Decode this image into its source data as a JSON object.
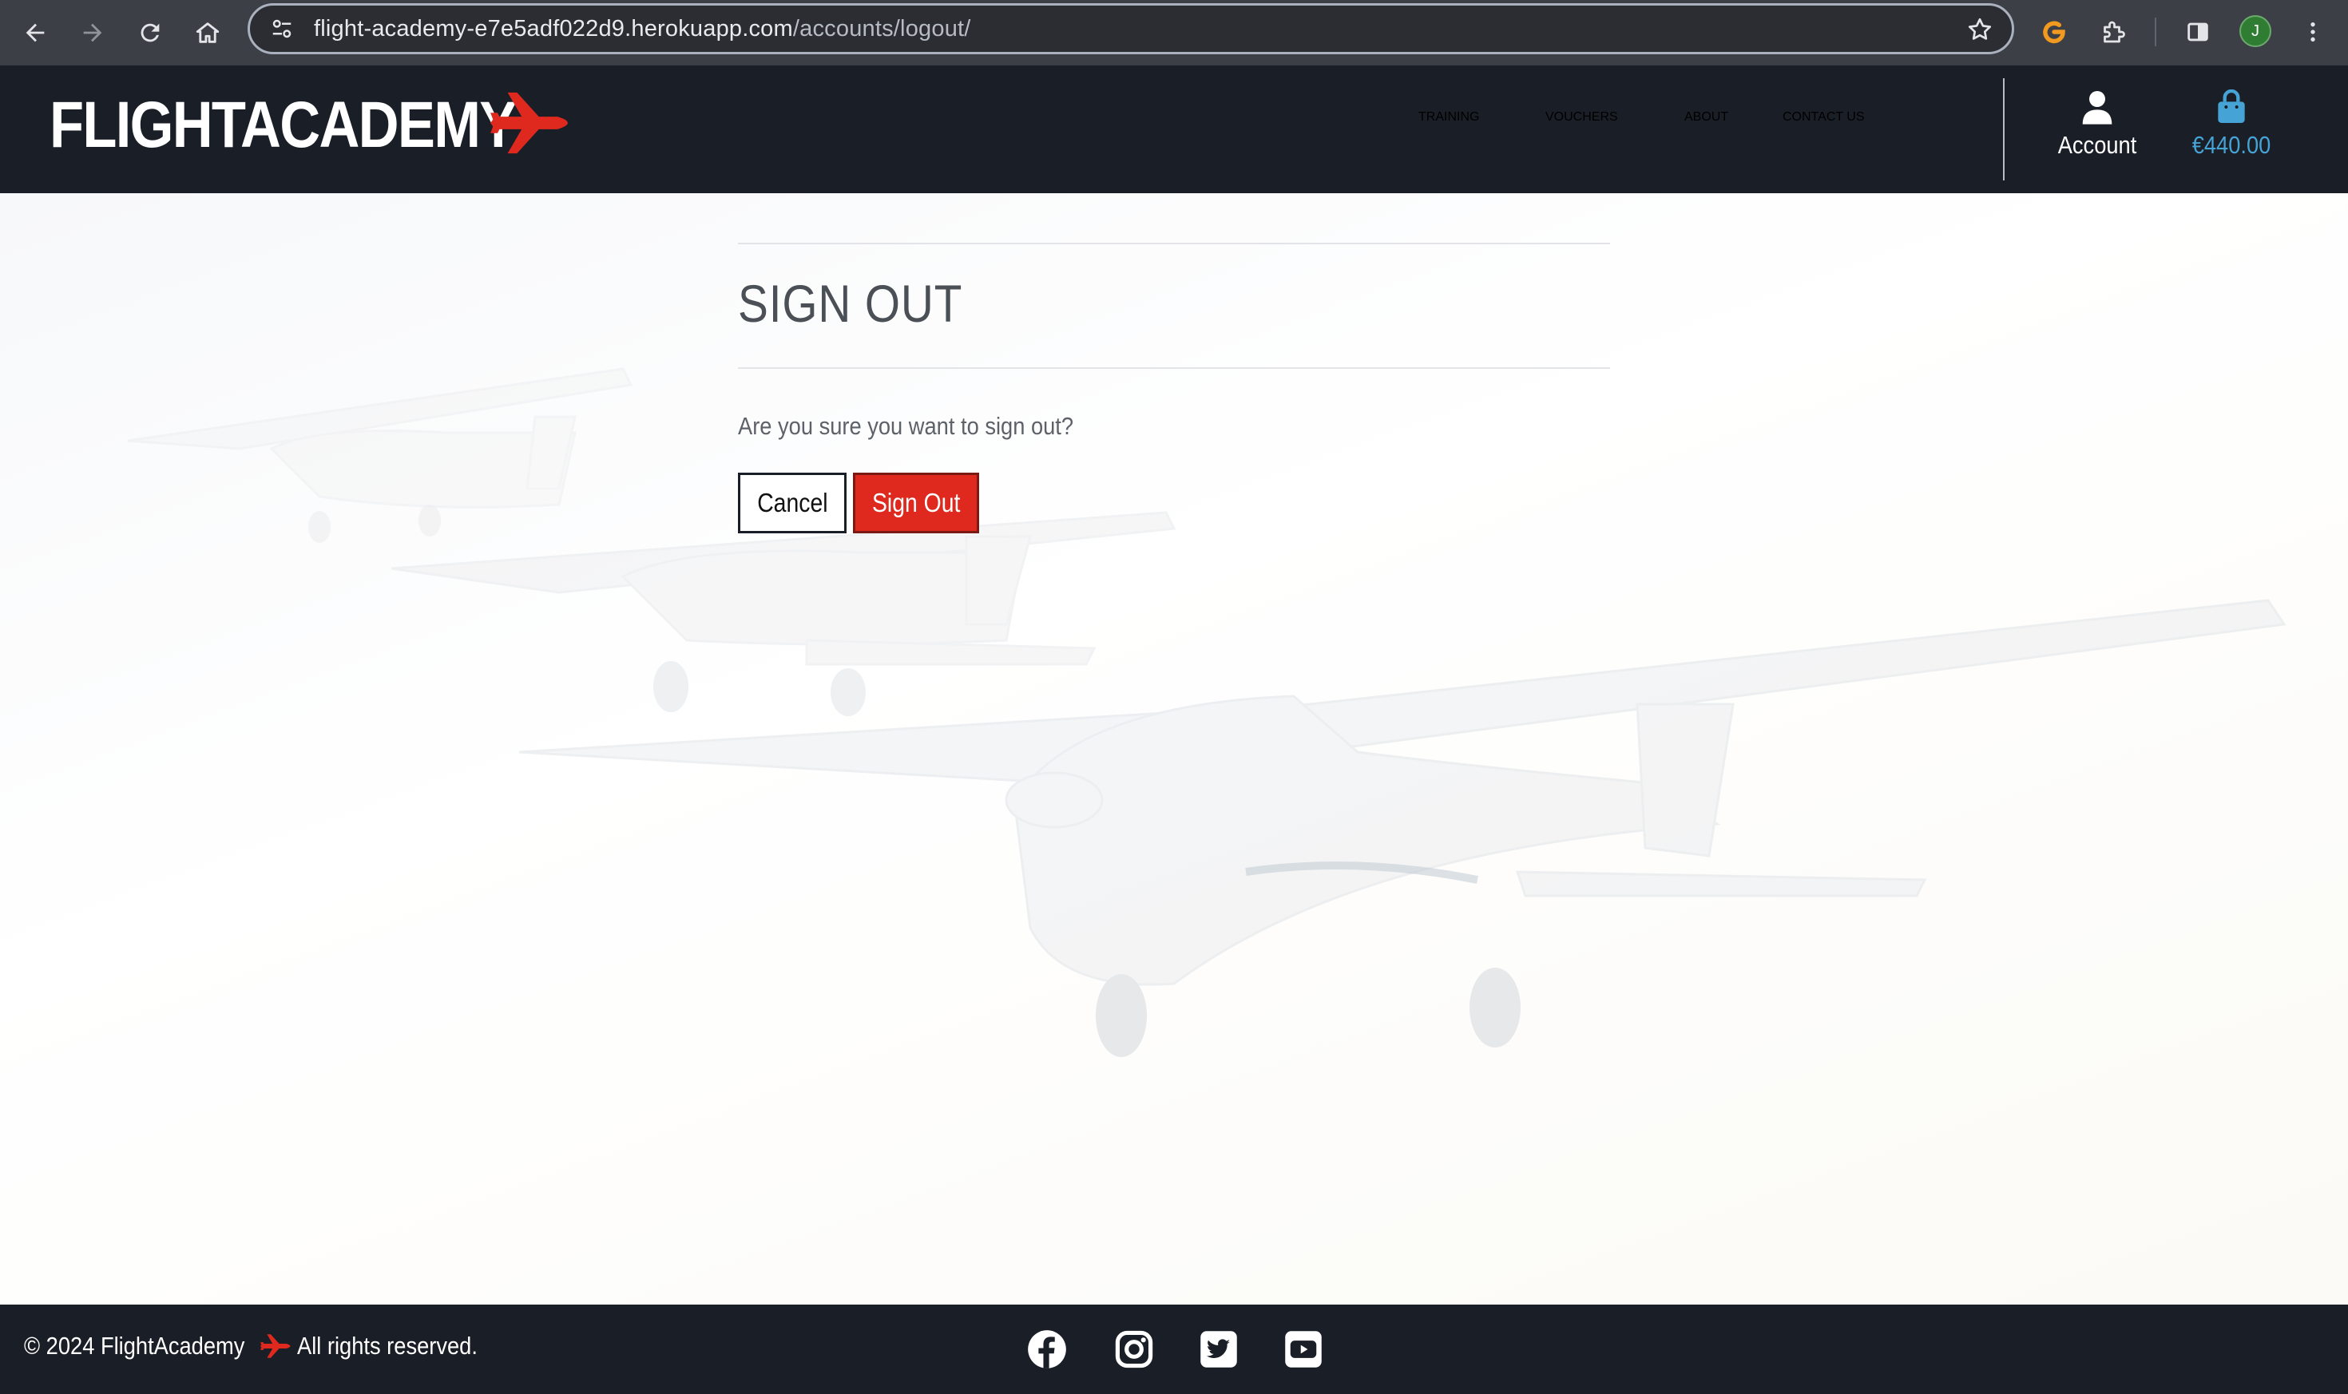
{
  "browser": {
    "url_host": "flight-academy-e7e5adf022d9.herokuapp.com",
    "url_path": "/accounts/logout/",
    "profile_initial": "J",
    "icons": [
      "back-arrow-icon",
      "forward-arrow-icon",
      "reload-icon",
      "home-icon",
      "site-info-icon",
      "star-icon",
      "extension-g-icon",
      "puzzle-icon",
      "sidebar-icon",
      "kebab-menu-icon"
    ]
  },
  "header": {
    "logo_text": "FLIGHTACADEMY",
    "nav": [
      "TRAINING",
      "VOUCHERS",
      "ABOUT",
      "CONTACT US"
    ],
    "account_label": "Account",
    "bag_total": "€440.00"
  },
  "main": {
    "title": "SIGN OUT",
    "question": "Are you sure you want to sign out?",
    "cancel_label": "Cancel",
    "signout_label": "Sign Out"
  },
  "footer": {
    "copyright_prefix": "© 2024 FlightAcademy",
    "copyright_suffix": "All rights reserved.",
    "social": [
      "facebook-icon",
      "instagram-icon",
      "twitter-icon",
      "youtube-icon"
    ]
  },
  "colors": {
    "header_bg": "#1a1e26",
    "accent_red": "#e0291e",
    "bag_blue": "#46a3d6",
    "chrome_bg": "#3c3f46"
  }
}
